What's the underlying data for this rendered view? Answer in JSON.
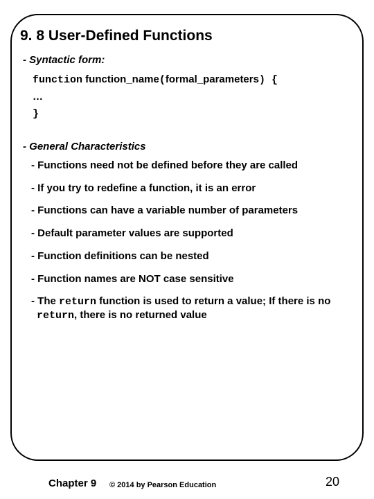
{
  "title": "9. 8 User-Defined Functions",
  "syntactic": {
    "label": "- Syntactic form:",
    "kw_function": "function",
    "fn_name": " function_name",
    "lparen": "(",
    "params": "formal_parameters",
    "rparen_brace": ") {",
    "ellipsis": " …",
    "close": "}"
  },
  "general_label": "- General Characteristics",
  "bullets": [
    "- Functions need not be defined before they are called",
    "- If you try to redefine a function, it is an error",
    "- Functions can have a variable number of parameters",
    "- Default parameter values are supported",
    "- Function definitions can be nested",
    "- Function names are NOT case sensitive"
  ],
  "return_bullet": {
    "p1": "- The ",
    "kw1": "return",
    "p2": " function is used to return a value; If there is no ",
    "kw2": "return",
    "p3": ", there is no returned value"
  },
  "footer": {
    "chapter": "Chapter 9",
    "copyright": "© 2014 by Pearson Education",
    "page": "20"
  }
}
